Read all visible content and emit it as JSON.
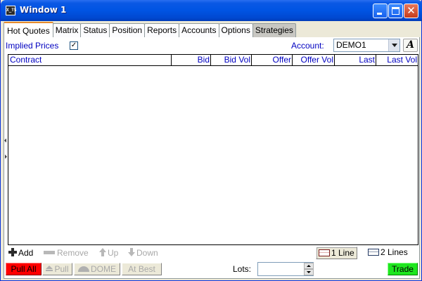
{
  "window": {
    "title": "Window 1",
    "app_icon_text": "X_TS",
    "close_glyph": "✕"
  },
  "tabs": [
    {
      "label": "Hot Quotes",
      "active": true
    },
    {
      "label": "Matrix"
    },
    {
      "label": "Status"
    },
    {
      "label": "Position"
    },
    {
      "label": "Reports"
    },
    {
      "label": "Accounts"
    },
    {
      "label": "Options"
    },
    {
      "label": "Strategies"
    }
  ],
  "filters": {
    "implied_prices_label": "Implied Prices",
    "implied_prices_checked": true,
    "checkbox_glyph": "✓",
    "account_label": "Account:",
    "account_value": "DEMO1",
    "font_button_label": "A"
  },
  "grid": {
    "columns": [
      "Contract",
      "Bid",
      "Bid Vol",
      "Offer",
      "Offer Vol",
      "Last",
      "Last Vol"
    ],
    "rows": []
  },
  "toolbar": {
    "add": "Add",
    "remove": "Remove",
    "up": "Up",
    "down": "Down",
    "one_line": "1 Line",
    "two_lines": "2 Lines"
  },
  "actions": {
    "pull_all": "Pull All",
    "pull": "Pull",
    "dome": "DOME",
    "at_best": "At Best",
    "lots_label": "Lots:",
    "lots_value": "",
    "trade": "Trade"
  },
  "colors": {
    "accent_blue": "#0000c0",
    "pull_all_bg": "#ff0000",
    "trade_bg": "#1ee61e",
    "titlebar": "#0054e3"
  }
}
